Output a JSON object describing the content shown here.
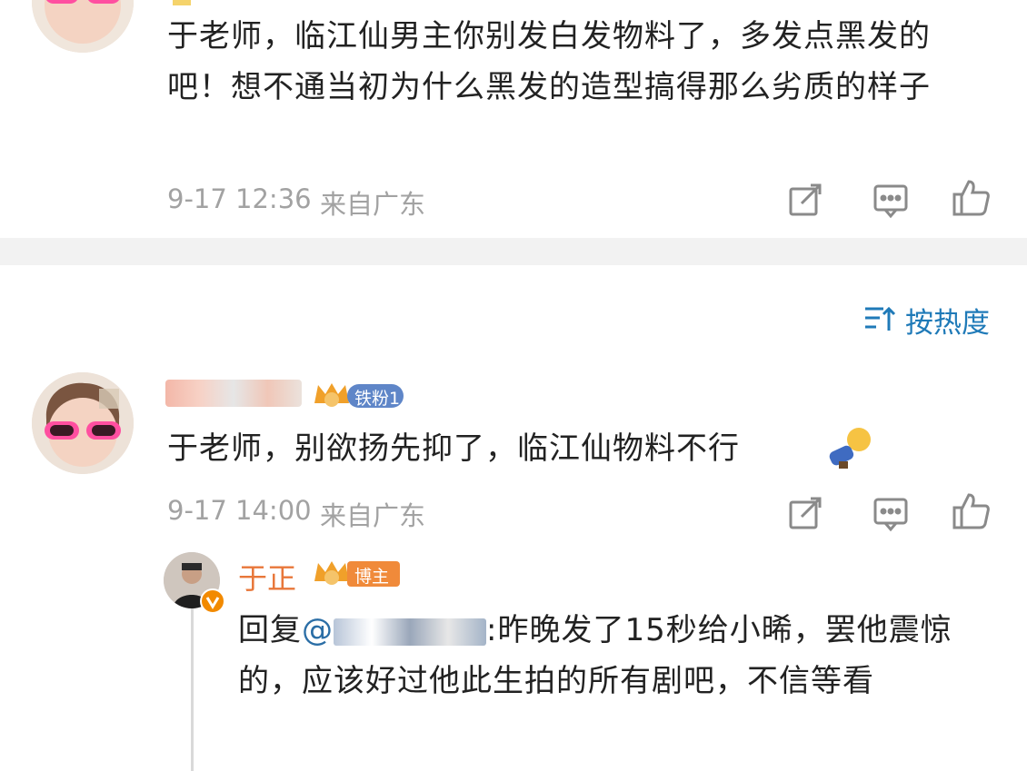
{
  "comment1": {
    "text": "于老师，临江仙男主你别发白发物料了，多发点黑发的吧！想不通当初为什么黑发的造型搞得那么劣质的样子",
    "time": "9-17 12:36",
    "location": "来自广东"
  },
  "sort": {
    "label": "按热度",
    "icon": "sort-icon"
  },
  "comment2": {
    "badge": "铁粉1",
    "text": "于老师，别欲扬先抑了，临江仙物料不行",
    "time": "9-17 14:00",
    "location": "来自广东"
  },
  "reply": {
    "username": "于正",
    "badge": "博主",
    "prefix": "回复",
    "at": "@",
    "text": ":昨晚发了15秒给小晞，罢他震惊的，应该好过他此生拍的所有剧吧，不信等看"
  },
  "colors": {
    "accent": "#1f7ab8",
    "username": "#e8773a",
    "badge_gold": "#f0a02a",
    "badge_orange": "#f08a3a",
    "meta": "#a2a2a2"
  }
}
